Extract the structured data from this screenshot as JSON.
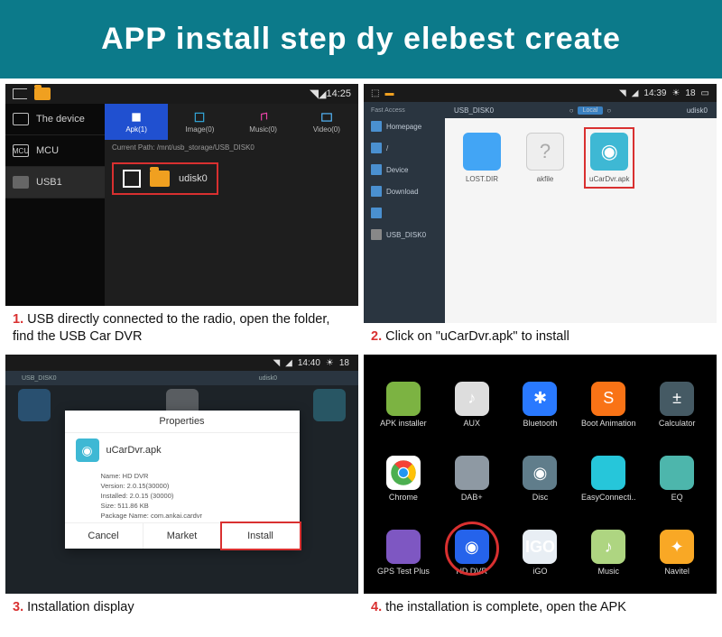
{
  "header": {
    "title": "APP install step dy elebest create"
  },
  "step1": {
    "status": {
      "time": "14:25"
    },
    "sidebar": [
      {
        "label": "The device"
      },
      {
        "label": "MCU"
      },
      {
        "label": "USB1"
      }
    ],
    "tabs": [
      {
        "label": "Apk(1)"
      },
      {
        "label": "Image(0)"
      },
      {
        "label": "Music(0)"
      },
      {
        "label": "Video(0)"
      }
    ],
    "path_label": "Current Path:",
    "path_value": "/mnt/usb_storage/USB_DISK0",
    "folder_name": "udisk0",
    "caption_num": "1.",
    "caption": "USB directly connected to the radio, open the folder, find the USB Car DVR"
  },
  "step2": {
    "status": {
      "time": "14:39",
      "temp": "18"
    },
    "sidebar_header": "Fast Access",
    "sidebar": [
      {
        "label": "Homepage"
      },
      {
        "label": "/"
      },
      {
        "label": "Device"
      },
      {
        "label": "Download"
      },
      {
        "label": ""
      },
      {
        "label": "USB_DISK0"
      }
    ],
    "crumb_left": "USB_DISK0",
    "crumb_loc": "Local",
    "crumb_right": "udisk0",
    "files": [
      {
        "label": "LOST.DIR",
        "kind": "fold"
      },
      {
        "label": "akfile",
        "kind": "unk"
      },
      {
        "label": "uCarDvr.apk",
        "kind": "apk"
      }
    ],
    "caption_num": "2.",
    "caption": "Click on \"uCarDvr.apk\" to install"
  },
  "step3": {
    "status": {
      "time": "14:40",
      "temp": "18"
    },
    "crumb_left": "USB_DISK0",
    "crumb_right": "udisk0",
    "dialog": {
      "title": "Properties",
      "apk_name": "uCarDvr.apk",
      "rows": [
        "Name: HD DVR",
        "Version: 2.0.15(30000)",
        "Installed: 2.0.15 (30000)",
        "Size: 511.86 KB",
        "Package Name: com.ankai.cardvr"
      ],
      "buttons": [
        {
          "label": "Cancel"
        },
        {
          "label": "Market"
        },
        {
          "label": "Install",
          "hl": true
        }
      ]
    },
    "caption_num": "3.",
    "caption": "Installation display"
  },
  "step4": {
    "apps": [
      {
        "label": "APK installer",
        "cls": "ic-android"
      },
      {
        "label": "AUX",
        "cls": "ic-aux",
        "glyph": "♪"
      },
      {
        "label": "Bluetooth",
        "cls": "ic-bt",
        "glyph": "✱"
      },
      {
        "label": "Boot Animation",
        "cls": "ic-boot",
        "glyph": "S"
      },
      {
        "label": "Calculator",
        "cls": "ic-calc",
        "glyph": "±"
      },
      {
        "label": "Chrome",
        "cls": "ic-chrome"
      },
      {
        "label": "DAB+",
        "cls": "ic-dab"
      },
      {
        "label": "Disc",
        "cls": "ic-disc",
        "glyph": "◉"
      },
      {
        "label": "EasyConnecti..",
        "cls": "ic-easy"
      },
      {
        "label": "EQ",
        "cls": "ic-eq"
      },
      {
        "label": "GPS Test Plus",
        "cls": "ic-gps"
      },
      {
        "label": "HD DVR",
        "cls": "ic-hddvr",
        "glyph": "◉",
        "circled": true
      },
      {
        "label": "iGO",
        "cls": "ic-igo",
        "glyph": "IGO"
      },
      {
        "label": "Music",
        "cls": "ic-music",
        "glyph": "♪"
      },
      {
        "label": "Navitel",
        "cls": "ic-navi",
        "glyph": "✦"
      }
    ],
    "caption_num": "4.",
    "caption": "the installation is complete, open the APK"
  }
}
